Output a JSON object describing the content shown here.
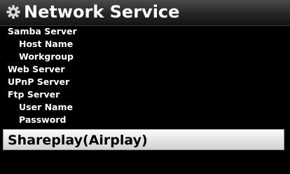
{
  "header": {
    "icon": "gear-icon",
    "title": "Network Service"
  },
  "menu": {
    "items": [
      {
        "label": "Samba Server",
        "level": 0,
        "selected": false
      },
      {
        "label": "Host Name",
        "level": 1,
        "selected": false
      },
      {
        "label": "Workgroup",
        "level": 1,
        "selected": false
      },
      {
        "label": "Web Server",
        "level": 0,
        "selected": false
      },
      {
        "label": "UPnP Server",
        "level": 0,
        "selected": false
      },
      {
        "label": "Ftp Server",
        "level": 0,
        "selected": false
      },
      {
        "label": "User Name",
        "level": 1,
        "selected": false
      },
      {
        "label": "Password",
        "level": 1,
        "selected": false
      },
      {
        "label": "Shareplay(Airplay)",
        "level": 0,
        "selected": true
      }
    ]
  },
  "colors": {
    "background": "#000000",
    "text": "#ffffff",
    "selected_text": "#000000",
    "selected_background": "#e6e6e6"
  }
}
